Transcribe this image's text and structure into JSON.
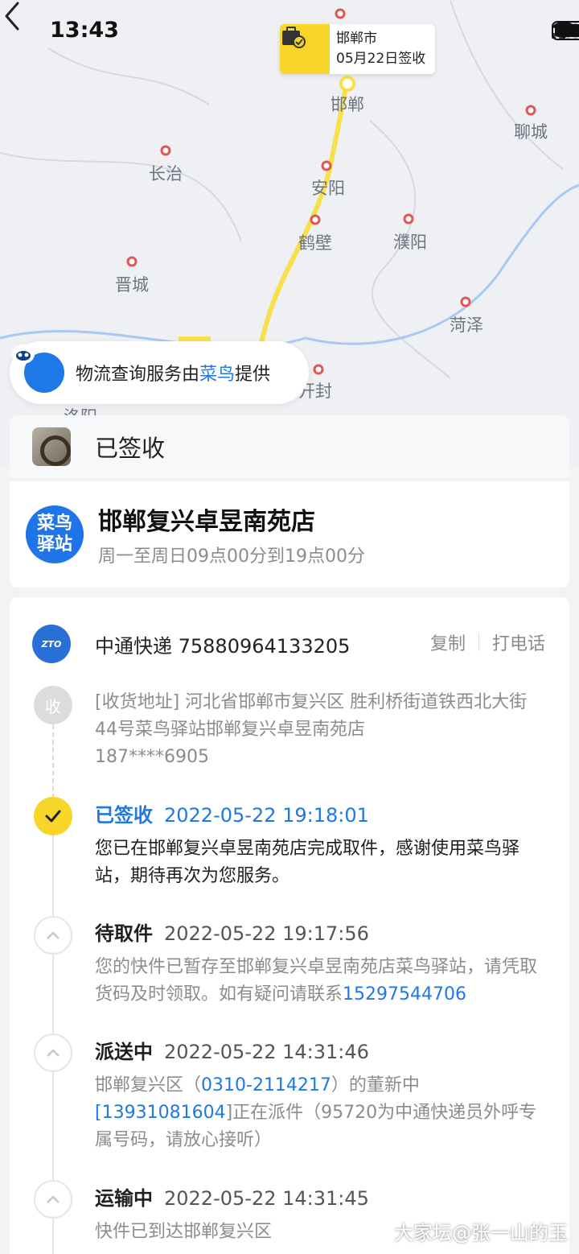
{
  "status_bar": {
    "time": "13:43"
  },
  "map": {
    "callout_city": "邯郸市",
    "callout_date": "05月22日签收",
    "cities": [
      "邯郸",
      "聊城",
      "长治",
      "安阳",
      "濮阳",
      "鹤壁",
      "晋城",
      "菏泽",
      "开封",
      "洛阳"
    ],
    "route_color": "#f9e04b"
  },
  "provider": {
    "prefix": "物流查询服务由",
    "brand": "菜鸟",
    "suffix": "提供"
  },
  "status_card": {
    "status": "已签收"
  },
  "station": {
    "logo_line1": "菜鸟",
    "logo_line2": "驿站",
    "name": "邯郸复兴卓昱南苑店",
    "hours": "周一至周日09点00分到19点00分"
  },
  "tracking": {
    "carrier_logo": "ZTO",
    "carrier_name": "中通快递 75880964133205",
    "copy_label": "复制",
    "call_label": "打电话",
    "address": {
      "node_label": "收",
      "text": "[收货地址] 河北省邯郸市复兴区 胜利桥街道铁西北大街44号菜鸟驿站邯郸复兴卓昱南苑店",
      "phone": "187****6905"
    },
    "events": [
      {
        "status": "已签收",
        "time": "2022-05-22 19:18:01",
        "body": "您已在邯郸复兴卓昱南苑店完成取件，感谢使用菜鸟驿站，期待再次为您服务。"
      },
      {
        "status": "待取件",
        "time": "2022-05-22 19:17:56",
        "body": "您的快件已暂存至邯郸复兴卓昱南苑店菜鸟驿站，请凭取货码及时领取。如有疑问请联系",
        "link": "15297544706"
      },
      {
        "status": "派送中",
        "time": "2022-05-22 14:31:46",
        "body_a": "邯郸复兴区（",
        "link_a": "0310-2114217",
        "body_b": "）的董新中",
        "link_b_prefix": "[",
        "link_b": "13931081604",
        "body_c": "]正在派件（95720为中通快递员外呼专属号码，请放心接听）"
      },
      {
        "status": "运输中",
        "time": "2022-05-22 14:31:45",
        "body": "快件已到达邯郸复兴区"
      }
    ]
  },
  "watermark": "大家坛@张一山的玉",
  "colors": {
    "accent": "#1e78e6",
    "signed": "#f7d629",
    "muted": "#8c8c8c"
  }
}
